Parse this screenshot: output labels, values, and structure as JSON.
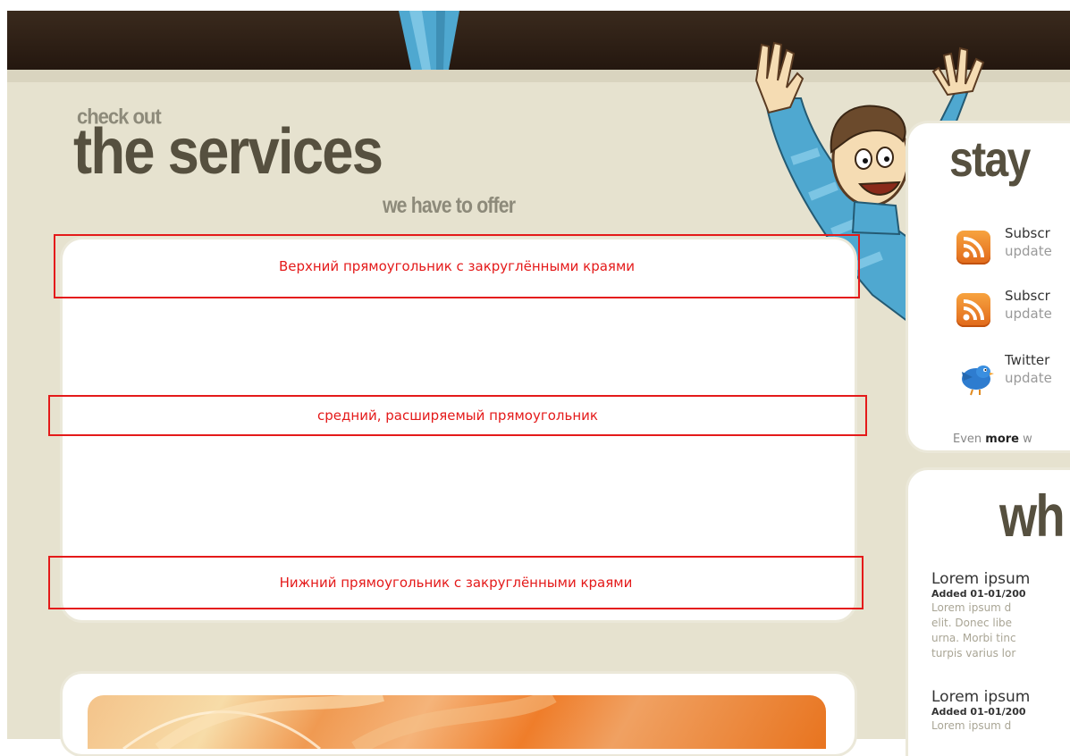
{
  "header": {
    "pre": "check out",
    "title": "the services",
    "sub": "we have to offer"
  },
  "annotations": {
    "top": "Верхний прямоугольник с закруглёнными краями",
    "middle": "средний, расширяемый прямоугольник",
    "bottom": "Нижний прямоугольник с закруглёнными краями"
  },
  "stay": {
    "heading": "stay",
    "items": [
      {
        "icon": "rss-icon",
        "line1": "Subscr",
        "line2": "update"
      },
      {
        "icon": "rss-icon",
        "line1": "Subscr",
        "line2": "update"
      },
      {
        "icon": "twitter-bird-icon",
        "line1": "Twitter",
        "line2": "update"
      }
    ],
    "more_prefix": "Even ",
    "more_bold": "more",
    "more_suffix": " w"
  },
  "news": {
    "heading": "wh",
    "items": [
      {
        "title": "Lorem ipsum",
        "date": "Added 01-01/200",
        "lines": [
          "Lorem ipsum d",
          "elit. Donec libe",
          "urna. Morbi tinc",
          "turpis varius lor"
        ]
      },
      {
        "title": "Lorem ipsum",
        "date": "Added 01-01/200",
        "lines": [
          "Lorem ipsum d"
        ]
      }
    ]
  },
  "colors": {
    "background": "#e6e2cf",
    "heading": "#56503f",
    "annotation": "#e41a1a"
  }
}
